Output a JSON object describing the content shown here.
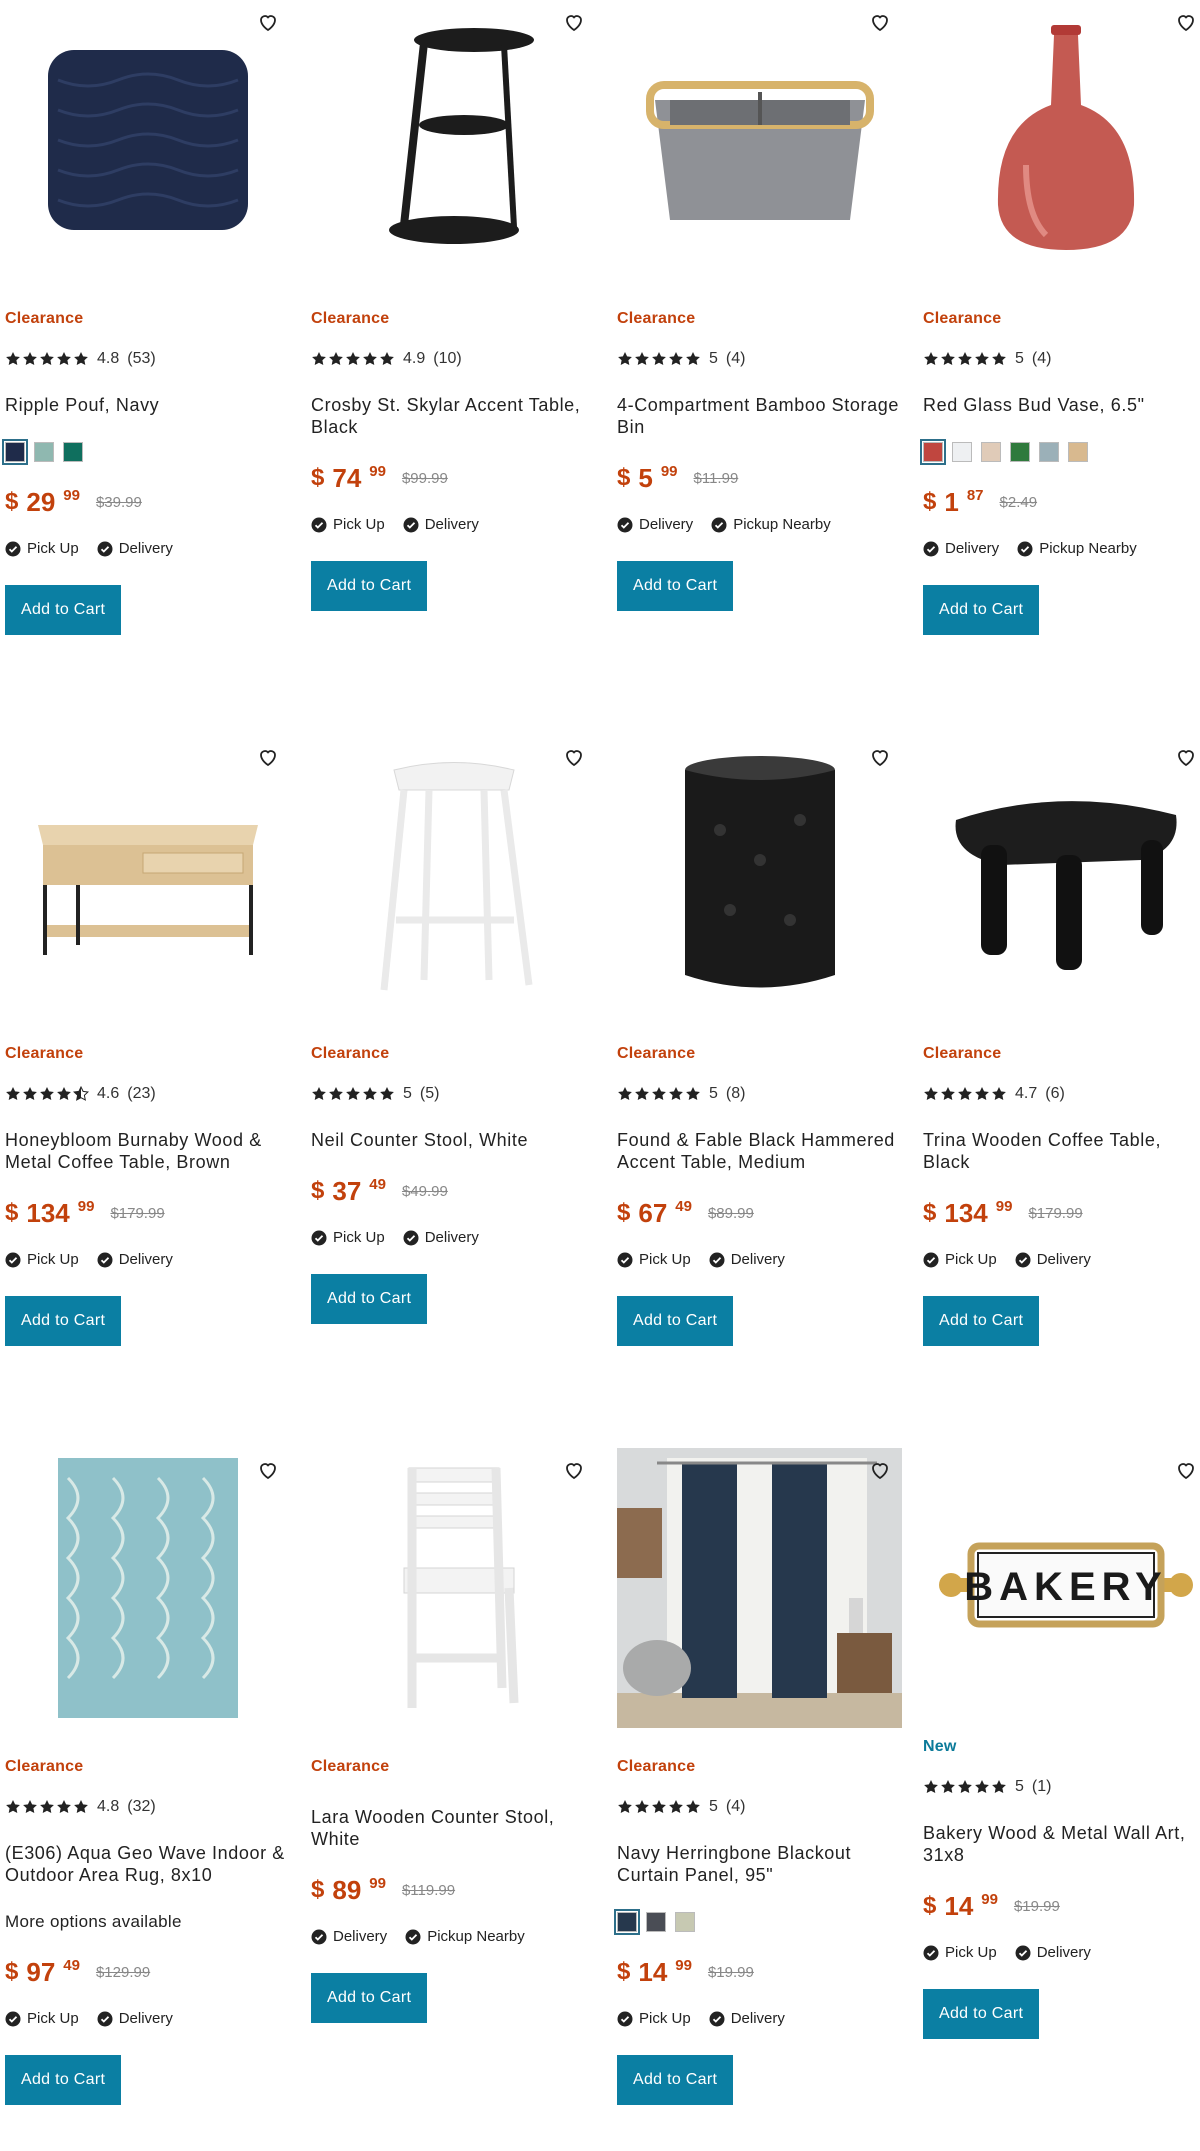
{
  "products": [
    {
      "badge": "Clearance",
      "rating": "4.8",
      "reviews": "(53)",
      "stars": 5,
      "title": "Ripple Pouf, Navy",
      "swatches": [
        "#1f2b4a",
        "#8fb8b0",
        "#0f6f5e"
      ],
      "price_dollars": "29",
      "price_cents": "99",
      "was": "$39.99",
      "fulfillment": [
        "Pick Up",
        "Delivery"
      ],
      "cta": "Add to Cart",
      "image_icon": "pouf-image"
    },
    {
      "badge": "Clearance",
      "rating": "4.9",
      "reviews": "(10)",
      "stars": 5,
      "title": "Crosby St. Skylar Accent Table, Black",
      "swatches": [],
      "price_dollars": "74",
      "price_cents": "99",
      "was": "$99.99",
      "fulfillment": [
        "Pick Up",
        "Delivery"
      ],
      "cta": "Add to Cart",
      "image_icon": "accent-table-image"
    },
    {
      "badge": "Clearance",
      "rating": "5",
      "reviews": "(4)",
      "stars": 5,
      "title": "4-Compartment Bamboo Storage Bin",
      "swatches": [],
      "price_dollars": "5",
      "price_cents": "99",
      "was": "$11.99",
      "fulfillment": [
        "Delivery",
        "Pickup Nearby"
      ],
      "cta": "Add to Cart",
      "image_icon": "storage-bin-image"
    },
    {
      "badge": "Clearance",
      "rating": "5",
      "reviews": "(4)",
      "stars": 5,
      "title": "Red Glass Bud Vase, 6.5\"",
      "swatches": [
        "#c0463f",
        "#eef0f2",
        "#e0cbb8",
        "#2f7a3c",
        "#9bb0b8",
        "#d8b98f"
      ],
      "price_dollars": "1",
      "price_cents": "87",
      "was": "$2.49",
      "fulfillment": [
        "Delivery",
        "Pickup Nearby"
      ],
      "cta": "Add to Cart",
      "image_icon": "vase-image"
    },
    {
      "badge": "Clearance",
      "rating": "4.6",
      "reviews": "(23)",
      "stars": 4.5,
      "title": "Honeybloom Burnaby Wood & Metal Coffee Table, Brown",
      "swatches": [],
      "price_dollars": "134",
      "price_cents": "99",
      "was": "$179.99",
      "fulfillment": [
        "Pick Up",
        "Delivery"
      ],
      "cta": "Add to Cart",
      "image_icon": "coffee-table-image"
    },
    {
      "badge": "Clearance",
      "rating": "5",
      "reviews": "(5)",
      "stars": 5,
      "title": "Neil Counter Stool, White",
      "swatches": [],
      "price_dollars": "37",
      "price_cents": "49",
      "was": "$49.99",
      "fulfillment": [
        "Pick Up",
        "Delivery"
      ],
      "cta": "Add to Cart",
      "image_icon": "stool-image"
    },
    {
      "badge": "Clearance",
      "rating": "5",
      "reviews": "(8)",
      "stars": 5,
      "title": "Found & Fable Black Hammered Accent Table, Medium",
      "swatches": [],
      "price_dollars": "67",
      "price_cents": "49",
      "was": "$89.99",
      "fulfillment": [
        "Pick Up",
        "Delivery"
      ],
      "cta": "Add to Cart",
      "image_icon": "drum-table-image"
    },
    {
      "badge": "Clearance",
      "rating": "4.7",
      "reviews": "(6)",
      "stars": 5,
      "title": "Trina Wooden Coffee Table, Black",
      "swatches": [],
      "price_dollars": "134",
      "price_cents": "99",
      "was": "$179.99",
      "fulfillment": [
        "Pick Up",
        "Delivery"
      ],
      "cta": "Add to Cart",
      "image_icon": "black-coffee-table-image"
    },
    {
      "badge": "Clearance",
      "rating": "4.8",
      "reviews": "(32)",
      "stars": 5,
      "title": "(E306) Aqua Geo Wave Indoor & Outdoor Area Rug, 8x10",
      "more": "More options available",
      "swatches": [],
      "price_dollars": "97",
      "price_cents": "49",
      "was": "$129.99",
      "fulfillment": [
        "Pick Up",
        "Delivery"
      ],
      "cta": "Add to Cart",
      "image_icon": "rug-image"
    },
    {
      "badge": "Clearance",
      "rating": "",
      "reviews": "",
      "stars": 0,
      "title": "Lara Wooden Counter Stool, White",
      "swatches": [],
      "price_dollars": "89",
      "price_cents": "99",
      "was": "$119.99",
      "fulfillment": [
        "Delivery",
        "Pickup Nearby"
      ],
      "cta": "Add to Cart",
      "image_icon": "chair-image"
    },
    {
      "badge": "Clearance",
      "rating": "5",
      "reviews": "(4)",
      "stars": 5,
      "title": "Navy Herringbone Blackout Curtain Panel, 95\"",
      "swatches": [
        "#26384d",
        "#4a4d55",
        "#c7c9b2"
      ],
      "price_dollars": "14",
      "price_cents": "99",
      "was": "$19.99",
      "fulfillment": [
        "Pick Up",
        "Delivery"
      ],
      "cta": "Add to Cart",
      "image_icon": "curtain-image"
    },
    {
      "badge": "New",
      "rating": "5",
      "reviews": "(1)",
      "stars": 5,
      "title": "Bakery Wood & Metal Wall Art, 31x8",
      "swatches": [],
      "price_dollars": "14",
      "price_cents": "99",
      "was": "$19.99",
      "fulfillment": [
        "Pick Up",
        "Delivery"
      ],
      "cta": "Add to Cart",
      "image_icon": "bakery-sign-image",
      "sign_text": "BAKERY"
    }
  ],
  "currency": "$",
  "colors": {
    "accent": "#c2410c",
    "button": "#0b7fa3",
    "new": "#0b7a99"
  }
}
